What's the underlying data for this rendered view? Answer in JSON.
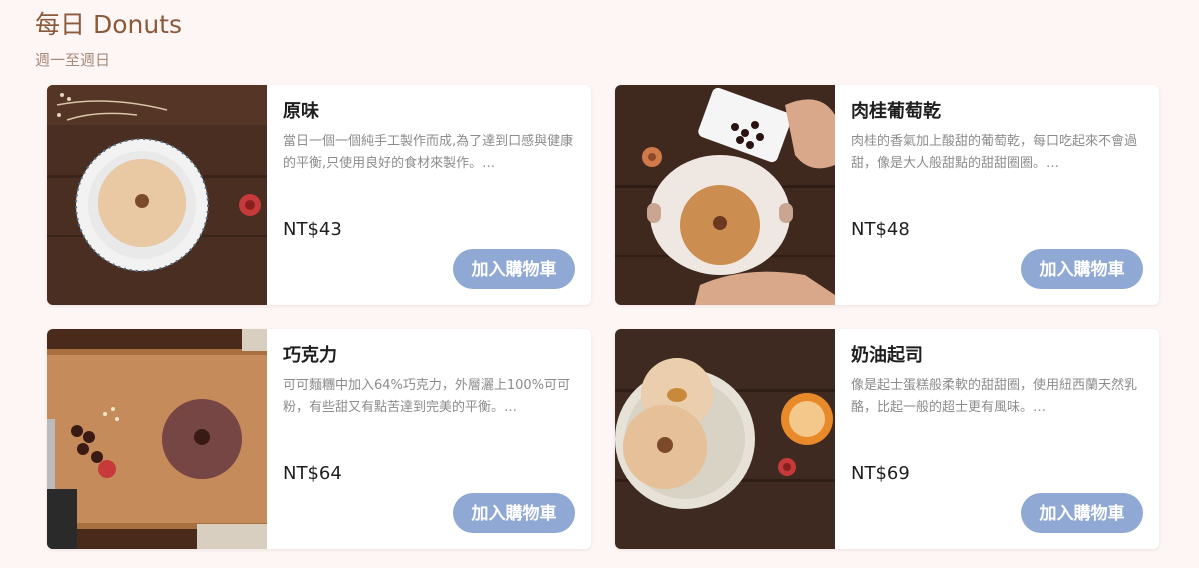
{
  "section": {
    "title": "每日 Donuts",
    "subtitle": "週一至週日"
  },
  "products": [
    {
      "name": "原味",
      "description": "當日一個一個純手工製作而成,為了達到口感與健康的平衡,只使用良好的食材來製作。…",
      "price": "NT$43",
      "button_label": "加入購物車"
    },
    {
      "name": "肉桂葡萄乾",
      "description": "肉桂的香氣加上酸甜的葡萄乾，每口吃起來不會過甜，像是大人般甜點的甜甜圈圈。…",
      "price": "NT$48",
      "button_label": "加入購物車"
    },
    {
      "name": "巧克力",
      "description": "可可麵糰中加入64%巧克力，外層灑上100%可可粉，有些甜又有點苦達到完美的平衡。…",
      "price": "NT$64",
      "button_label": "加入購物車"
    },
    {
      "name": "奶油起司",
      "description": "像是起士蛋糕般柔軟的甜甜圈，使用紐西蘭天然乳酪，比起一般的超士更有風味。…",
      "price": "NT$69",
      "button_label": "加入購物車"
    }
  ],
  "colors": {
    "heading": "#8a5a3a",
    "button": "#8fa8d4",
    "background": "#fdf6f5"
  }
}
